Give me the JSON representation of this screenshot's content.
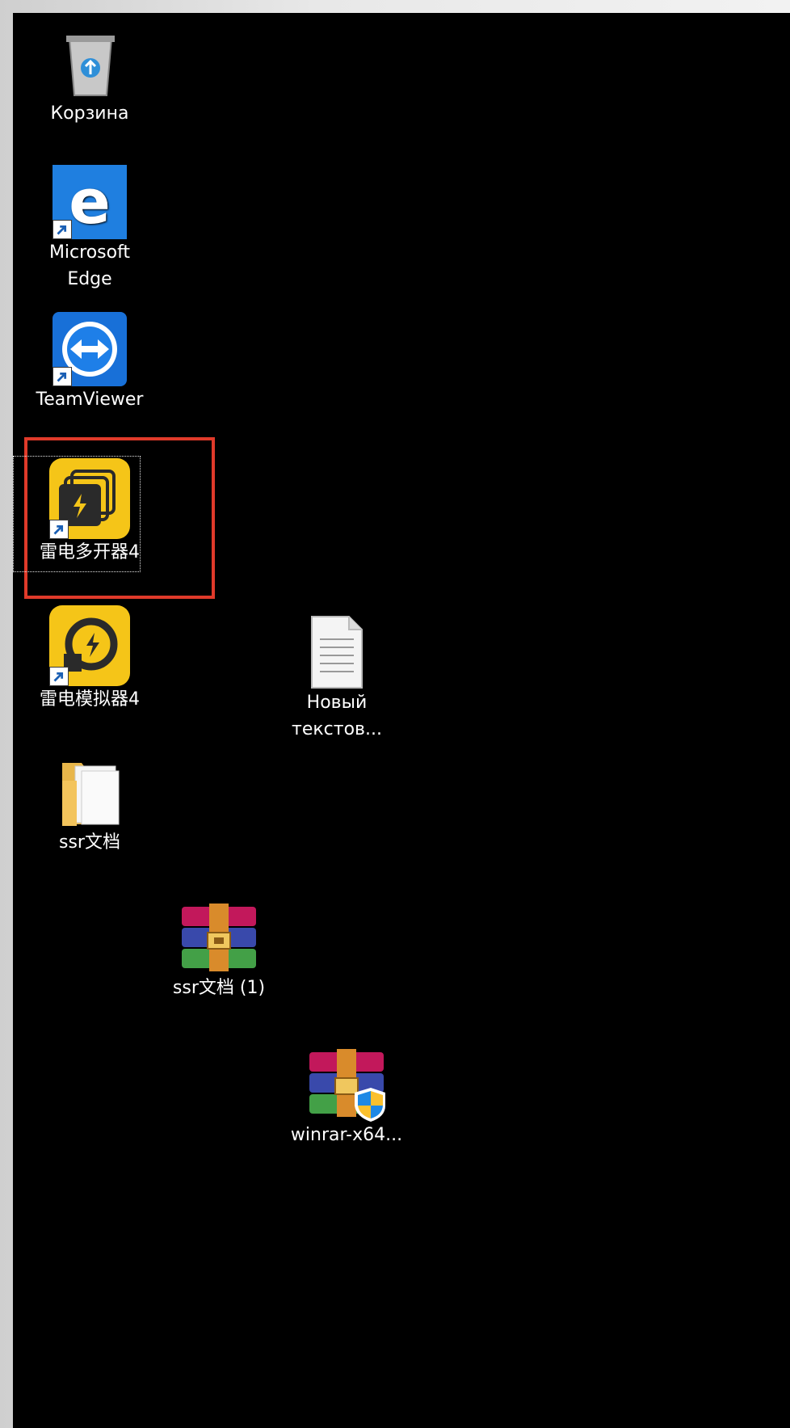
{
  "desktop": {
    "accent_color": "#e03a2a",
    "icons": [
      {
        "label": "Корзина",
        "icon": "recycle-bin-icon"
      },
      {
        "label_line1": "Microsoft",
        "label_line2": "Edge",
        "icon": "edge-icon"
      },
      {
        "label": "TeamViewer",
        "icon": "teamviewer-icon"
      },
      {
        "label": "雷电多开器4",
        "icon": "ldmultiplayer-icon"
      },
      {
        "label": "雷电模拟器4",
        "icon": "ldplayer-icon"
      },
      {
        "label_line1": "Новый",
        "label_line2": "текстов...",
        "icon": "text-document-icon"
      },
      {
        "label": "ssr文档",
        "icon": "folder-icon"
      },
      {
        "label": "ssr文档 (1)",
        "icon": "winrar-archive-icon"
      },
      {
        "label": "winrar-x64...",
        "icon": "winrar-installer-icon"
      }
    ]
  }
}
